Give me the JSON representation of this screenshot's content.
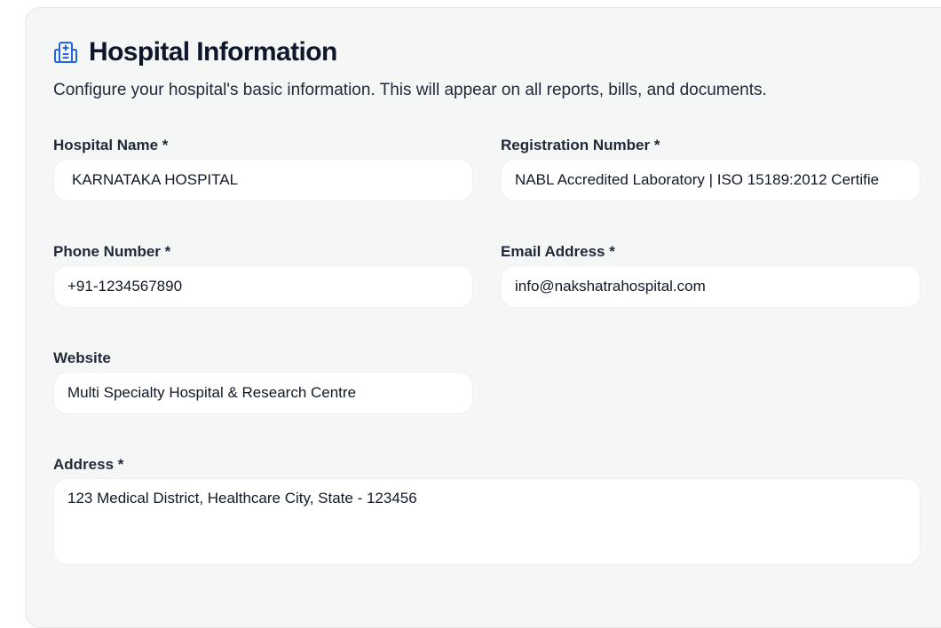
{
  "section": {
    "title": "Hospital Information",
    "icon": "hospital-building-icon",
    "subtitle": "Configure your hospital's basic information. This will appear on all reports, bills, and documents."
  },
  "fields": {
    "hospital_name": {
      "label": "Hospital Name *",
      "value": "KARNATAKA HOSPITAL"
    },
    "registration_number": {
      "label": "Registration Number *",
      "value": "NABL Accredited Laboratory | ISO 15189:2012 Certifie"
    },
    "phone_number": {
      "label": "Phone Number *",
      "value": "+91-1234567890"
    },
    "email_address": {
      "label": "Email Address *",
      "value": "info@nakshatrahospital.com"
    },
    "website": {
      "label": "Website",
      "value": "Multi Specialty Hospital & Research Centre"
    },
    "address": {
      "label": "Address *",
      "value": "123 Medical District, Healthcare City, State - 123456"
    }
  },
  "colors": {
    "accent": "#2563eb",
    "card_background": "#f5f6f6",
    "input_background": "#ffffff"
  }
}
